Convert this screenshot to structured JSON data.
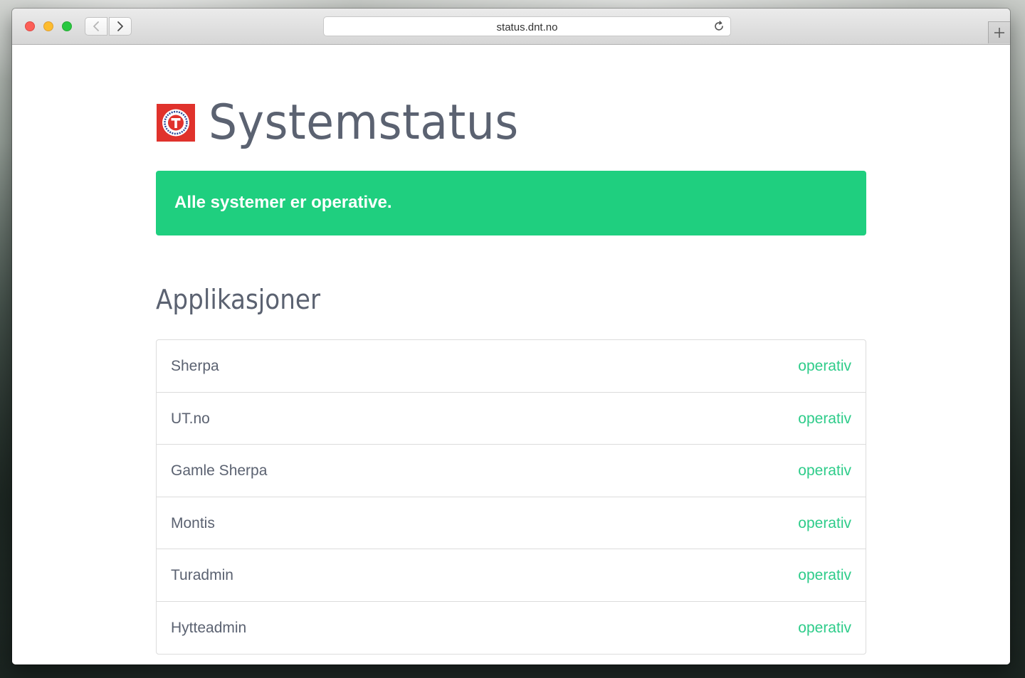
{
  "browser": {
    "url": "status.dnt.no",
    "accent_close": "#fc5f57",
    "accent_min": "#fdbc2e",
    "accent_max": "#28c840"
  },
  "page": {
    "title": "Systemstatus",
    "banner_text": "Alle systemer er operative.",
    "banner_color": "#1fcf7f",
    "section_title": "Applikasjoner"
  },
  "apps": [
    {
      "name": "Sherpa",
      "status": "operativ"
    },
    {
      "name": "UT.no",
      "status": "operativ"
    },
    {
      "name": "Gamle Sherpa",
      "status": "operativ"
    },
    {
      "name": "Montis",
      "status": "operativ"
    },
    {
      "name": "Turadmin",
      "status": "operativ"
    },
    {
      "name": "Hytteadmin",
      "status": "operativ"
    }
  ],
  "icons": {
    "back": "chevron-left-icon",
    "forward": "chevron-right-icon",
    "reload": "reload-icon",
    "new_tab": "plus-icon",
    "logo": "dnt-logo"
  }
}
